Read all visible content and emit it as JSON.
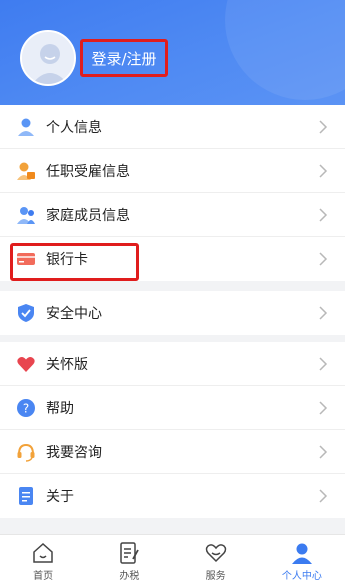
{
  "header": {
    "login_label": "登录/注册"
  },
  "menu_group1": [
    {
      "label": "个人信息",
      "icon": "person-icon"
    },
    {
      "label": "任职受雇信息",
      "icon": "employment-icon"
    },
    {
      "label": "家庭成员信息",
      "icon": "family-icon"
    },
    {
      "label": "银行卡",
      "icon": "bank-card-icon"
    }
  ],
  "menu_group2": [
    {
      "label": "安全中心",
      "icon": "shield-icon"
    }
  ],
  "menu_group3": [
    {
      "label": "关怀版",
      "icon": "heart-icon"
    },
    {
      "label": "帮助",
      "icon": "help-icon"
    },
    {
      "label": "我要咨询",
      "icon": "headset-icon"
    },
    {
      "label": "关于",
      "icon": "document-icon"
    }
  ],
  "tabbar": [
    {
      "label": "首页",
      "icon": "home-icon"
    },
    {
      "label": "办税",
      "icon": "tax-icon"
    },
    {
      "label": "服务",
      "icon": "service-icon"
    },
    {
      "label": "个人中心",
      "icon": "user-center-icon",
      "active": true
    }
  ],
  "colors": {
    "header_blue": "#4a86f2",
    "highlight_red": "#e01d1d",
    "active_tab": "#3b7bf0"
  }
}
